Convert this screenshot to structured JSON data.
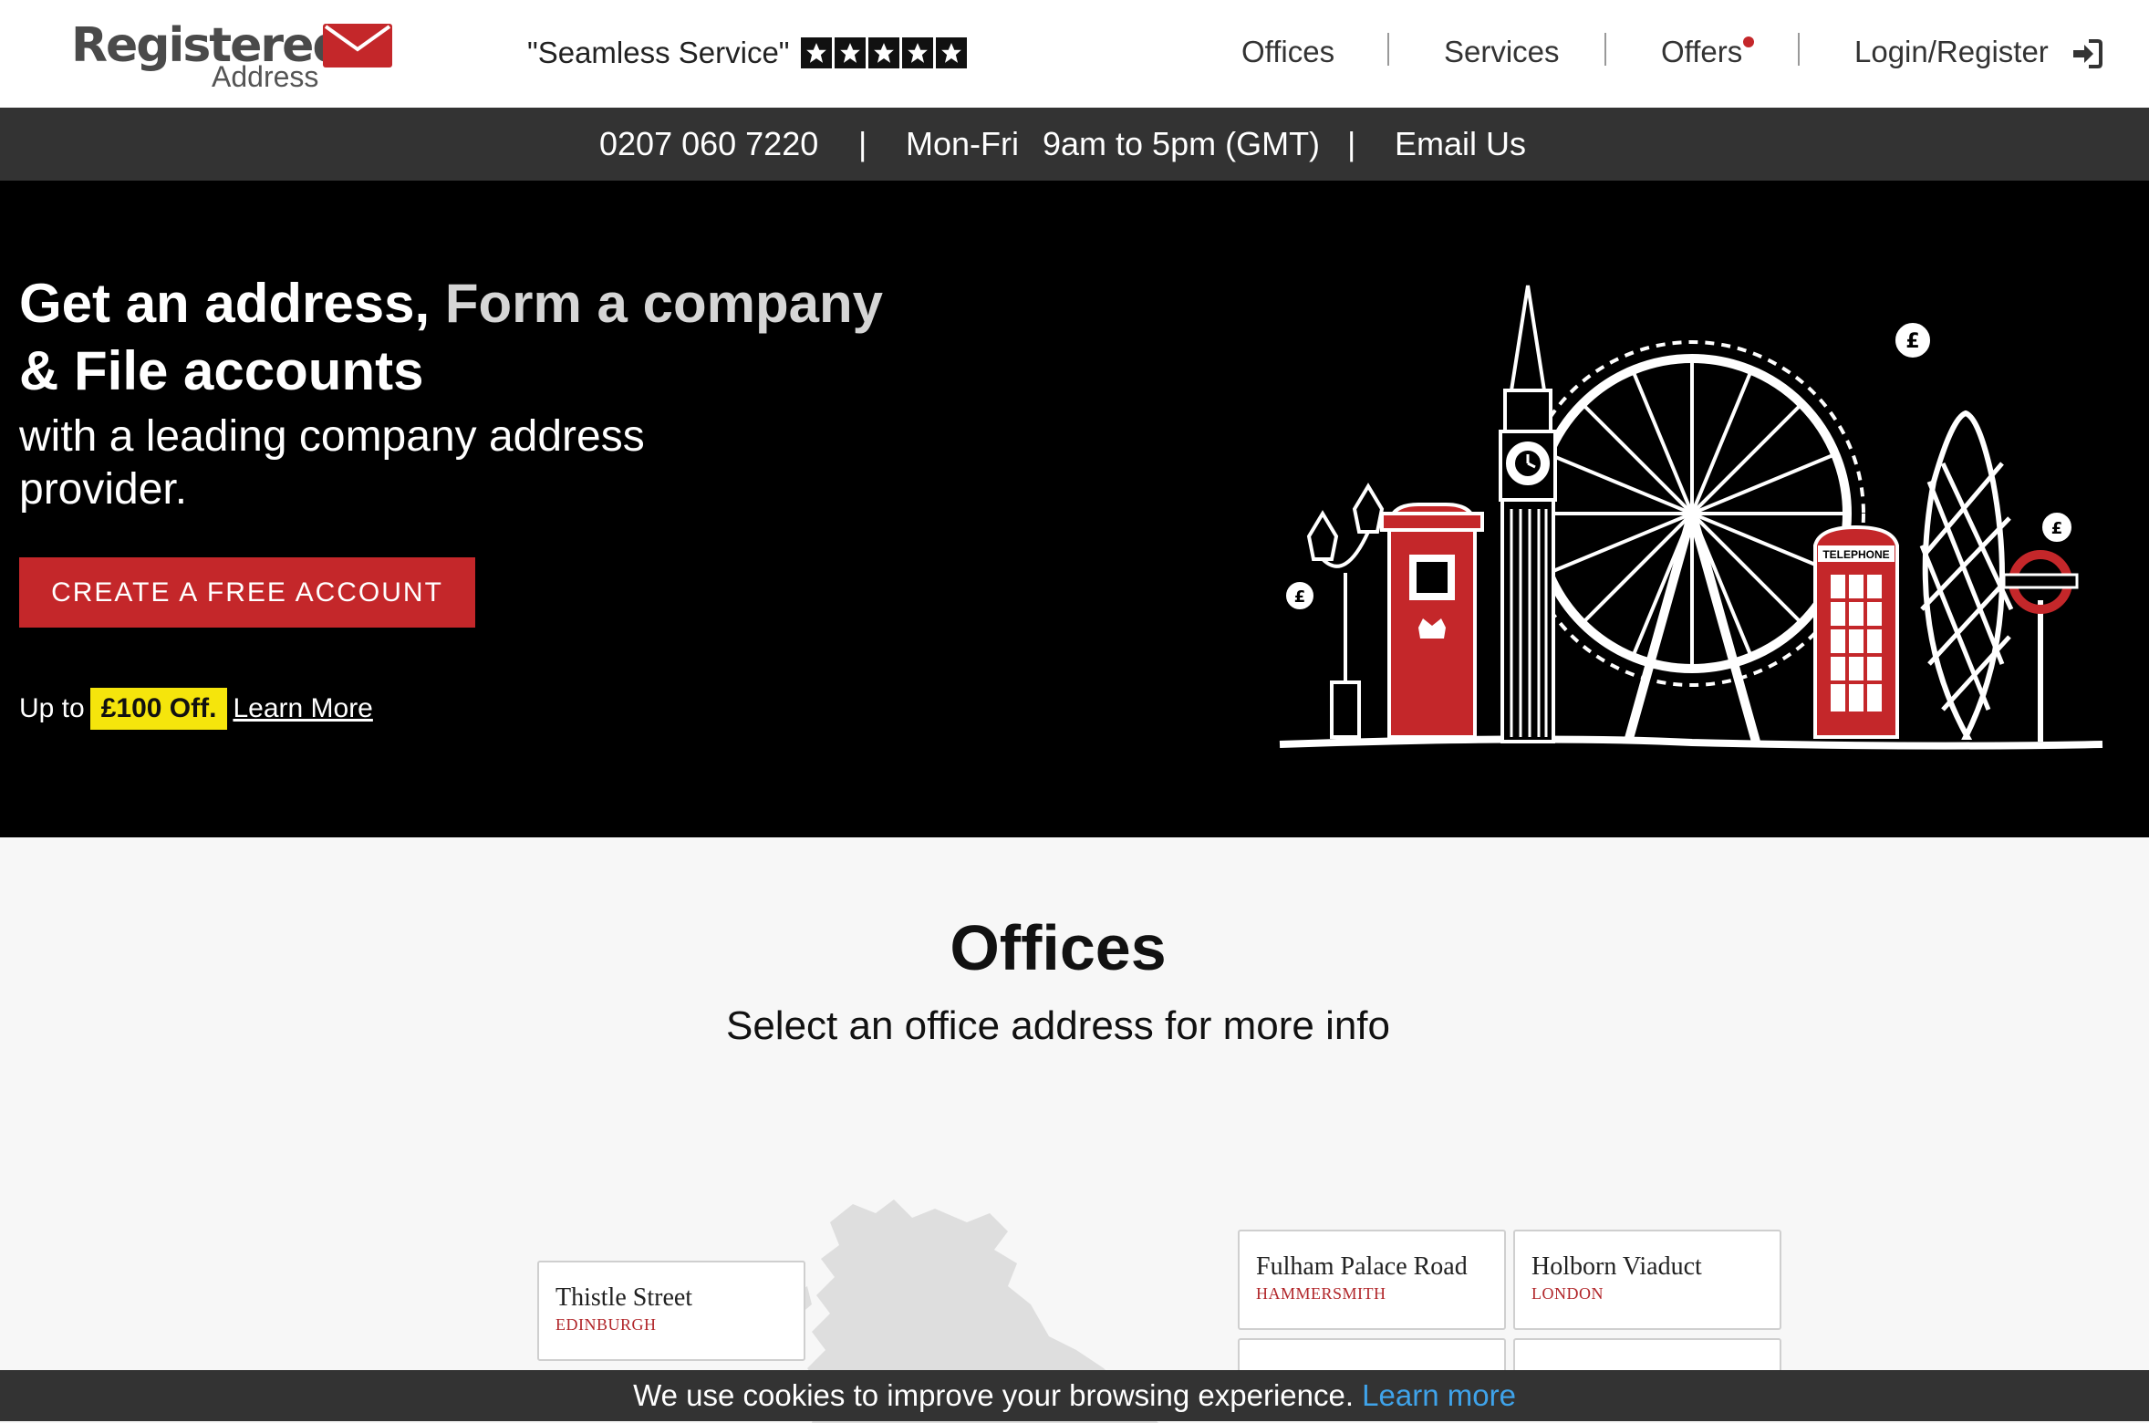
{
  "header": {
    "logo_text": "Registered",
    "logo_sub": "Address",
    "tagline": "\"Seamless Service\"",
    "rating_stars": 5,
    "nav": {
      "offices": "Offices",
      "services": "Services",
      "offers": "Offers",
      "login": "Login/Register"
    }
  },
  "contact_bar": {
    "phone": "0207 060 7220",
    "sep1": "|",
    "days": "Mon-Fri",
    "hours": "9am to 5pm (GMT)",
    "sep2": "|",
    "email": "Email Us"
  },
  "hero": {
    "headline_part1": "Get an address, ",
    "headline_part2": "Form a company",
    "headline_part3": "& File accounts",
    "subheadline": "with a leading company address provider.",
    "cta_label": "CREATE A FREE ACCOUNT",
    "promo_prefix": "Up to",
    "promo_badge": "£100 Off.",
    "promo_link": "Learn More",
    "telephone_box_label": "TELEPHONE"
  },
  "offices": {
    "title": "Offices",
    "subtitle": "Select an office address for more info",
    "cards": [
      {
        "name": "Thistle Street",
        "area": "EDINBURGH"
      },
      {
        "name": "Fulham Palace Road",
        "area": "HAMMERSMITH"
      },
      {
        "name": "Holborn Viaduct",
        "area": "LONDON"
      }
    ]
  },
  "cookie": {
    "text": "We use cookies to improve your browsing experience.",
    "link": "Learn more"
  },
  "colors": {
    "brand_red": "#c4272a",
    "contact_bar": "#333333",
    "hero_bg": "#000000",
    "promo_yellow": "#f5e50c",
    "cookie_link": "#3fa3ea"
  }
}
